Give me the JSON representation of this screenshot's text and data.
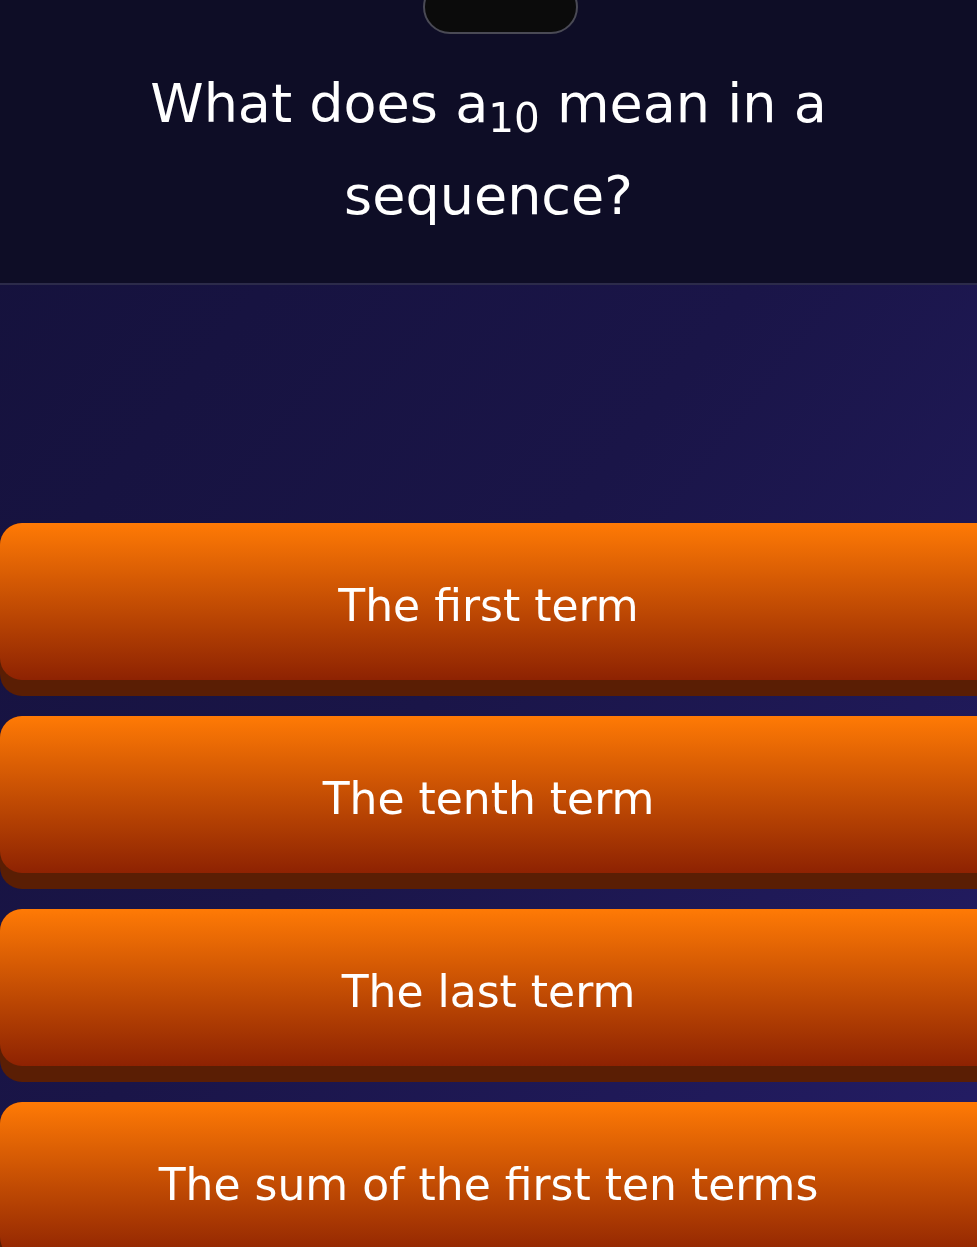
{
  "question": "What does a$_{10}$ mean in a sequence?",
  "answers": [
    {
      "label": "The first term"
    },
    {
      "label": "The tenth term"
    },
    {
      "label": "The last term"
    },
    {
      "label": "The sum of the first ten terms"
    }
  ]
}
